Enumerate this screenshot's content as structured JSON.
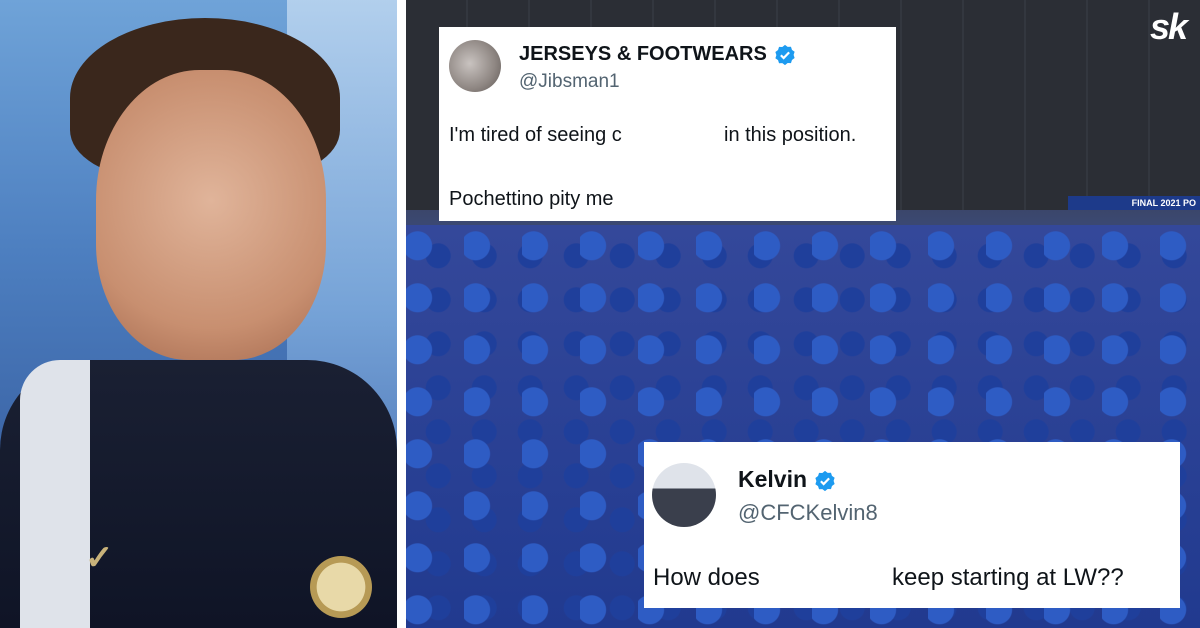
{
  "logo": {
    "text": "sk"
  },
  "banner": {
    "text": "FINAL 2021 PO"
  },
  "tweets": [
    {
      "display_name": "JERSEYS & FOOTWEARS",
      "handle": "@Jibsman1",
      "verified": true,
      "line1_part1": "I'm tired of seeing с",
      "line1_part2": "in this position.",
      "line2": "Pochettino pity me"
    },
    {
      "display_name": "Kelvin",
      "handle": "@CFCKelvin8",
      "verified": true,
      "line1_part1": "How does",
      "line1_part2": "keep starting at LW??"
    }
  ],
  "colors": {
    "verified_badge": "#1d9bf0",
    "handle_text": "#536471",
    "tweet_text": "#0f1419"
  }
}
